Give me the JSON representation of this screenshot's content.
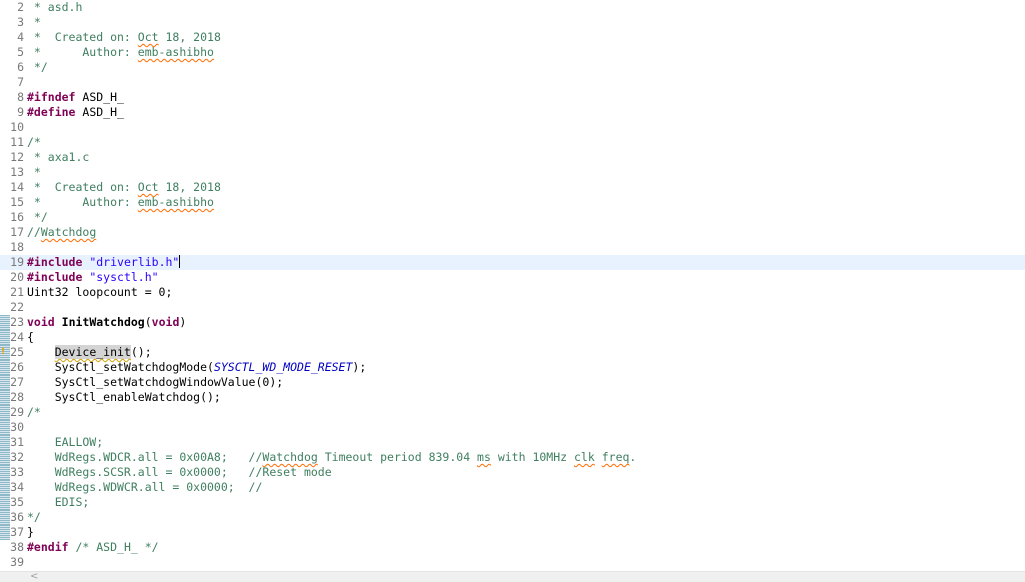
{
  "editor": {
    "current_line": "19",
    "lines": [
      {
        "num": "2",
        "tokens": [
          {
            "t": " * asd.h",
            "c": "cm"
          }
        ]
      },
      {
        "num": "3",
        "tokens": [
          {
            "t": " *",
            "c": "cm"
          }
        ]
      },
      {
        "num": "4",
        "tokens": [
          {
            "t": " *  Created on: ",
            "c": "cm"
          },
          {
            "t": "Oct",
            "c": "cm sq"
          },
          {
            "t": " 18, 2018",
            "c": "cm"
          }
        ]
      },
      {
        "num": "5",
        "tokens": [
          {
            "t": " *      Author: ",
            "c": "cm"
          },
          {
            "t": "emb-ashibho",
            "c": "cm sq"
          }
        ]
      },
      {
        "num": "6",
        "tokens": [
          {
            "t": " */",
            "c": "cm"
          }
        ]
      },
      {
        "num": "7",
        "tokens": []
      },
      {
        "num": "8",
        "tokens": [
          {
            "t": "#ifndef",
            "c": "pre"
          },
          {
            "t": " ASD_H_",
            "c": ""
          }
        ]
      },
      {
        "num": "9",
        "tokens": [
          {
            "t": "#define",
            "c": "pre"
          },
          {
            "t": " ASD_H_",
            "c": ""
          }
        ]
      },
      {
        "num": "10",
        "tokens": []
      },
      {
        "num": "11",
        "tokens": [
          {
            "t": "/*",
            "c": "cm"
          }
        ]
      },
      {
        "num": "12",
        "tokens": [
          {
            "t": " * axa1.c",
            "c": "cm"
          }
        ]
      },
      {
        "num": "13",
        "tokens": [
          {
            "t": " *",
            "c": "cm"
          }
        ]
      },
      {
        "num": "14",
        "tokens": [
          {
            "t": " *  Created on: ",
            "c": "cm"
          },
          {
            "t": "Oct",
            "c": "cm sq"
          },
          {
            "t": " 18, 2018",
            "c": "cm"
          }
        ]
      },
      {
        "num": "15",
        "tokens": [
          {
            "t": " *      Author: ",
            "c": "cm"
          },
          {
            "t": "emb-ashibho",
            "c": "cm sq"
          }
        ]
      },
      {
        "num": "16",
        "tokens": [
          {
            "t": " */",
            "c": "cm"
          }
        ]
      },
      {
        "num": "17",
        "tokens": [
          {
            "t": "//",
            "c": "cm"
          },
          {
            "t": "Watchdog",
            "c": "cm sq"
          }
        ]
      },
      {
        "num": "18",
        "tokens": []
      },
      {
        "num": "19",
        "tokens": [
          {
            "t": "#include",
            "c": "pre"
          },
          {
            "t": " ",
            "c": ""
          },
          {
            "t": "\"driverlib.h\"",
            "c": "str"
          }
        ]
      },
      {
        "num": "20",
        "tokens": [
          {
            "t": "#include",
            "c": "pre"
          },
          {
            "t": " ",
            "c": ""
          },
          {
            "t": "\"sysctl.h\"",
            "c": "str"
          }
        ]
      },
      {
        "num": "21",
        "tokens": [
          {
            "t": "Uint32 loopcount = 0;",
            "c": ""
          }
        ]
      },
      {
        "num": "22",
        "tokens": []
      },
      {
        "num": "23",
        "tokens": [
          {
            "t": "void",
            "c": "kw"
          },
          {
            "t": " ",
            "c": ""
          },
          {
            "t": "InitWatchdog",
            "c": "fn-decl"
          },
          {
            "t": "(",
            "c": ""
          },
          {
            "t": "void",
            "c": "kw"
          },
          {
            "t": ")",
            "c": ""
          }
        ]
      },
      {
        "num": "24",
        "tokens": [
          {
            "t": "{",
            "c": ""
          }
        ]
      },
      {
        "num": "25",
        "tokens": [
          {
            "t": "    ",
            "c": ""
          },
          {
            "t": "Device_init",
            "c": "hl warnsq"
          },
          {
            "t": "();",
            "c": ""
          }
        ]
      },
      {
        "num": "26",
        "tokens": [
          {
            "t": "    SysCtl_setWatchdogMode(",
            "c": ""
          },
          {
            "t": "SYSCTL_WD_MODE_RESET",
            "c": "macro"
          },
          {
            "t": ");",
            "c": ""
          }
        ]
      },
      {
        "num": "27",
        "tokens": [
          {
            "t": "    SysCtl_setWatchdogWindowValue(0);",
            "c": ""
          }
        ]
      },
      {
        "num": "28",
        "tokens": [
          {
            "t": "    SysCtl_enableWatchdog();",
            "c": ""
          }
        ]
      },
      {
        "num": "29",
        "tokens": [
          {
            "t": "/*",
            "c": "cm"
          }
        ]
      },
      {
        "num": "30",
        "tokens": []
      },
      {
        "num": "31",
        "tokens": [
          {
            "t": "    EALLOW;",
            "c": "cm"
          }
        ]
      },
      {
        "num": "32",
        "tokens": [
          {
            "t": "    WdRegs.WDCR.all = 0x00A8;   //",
            "c": "cm"
          },
          {
            "t": "Watchdog",
            "c": "cm sq"
          },
          {
            "t": " Timeout period 839.04 ",
            "c": "cm"
          },
          {
            "t": "ms",
            "c": "cm sq"
          },
          {
            "t": " with 10MHz ",
            "c": "cm"
          },
          {
            "t": "clk",
            "c": "cm sq"
          },
          {
            "t": " ",
            "c": "cm"
          },
          {
            "t": "freq",
            "c": "cm sq"
          },
          {
            "t": ".",
            "c": "cm"
          }
        ]
      },
      {
        "num": "33",
        "tokens": [
          {
            "t": "    WdRegs.SCSR.all = 0x0000;   //Reset mode",
            "c": "cm"
          }
        ]
      },
      {
        "num": "34",
        "tokens": [
          {
            "t": "    WdRegs.WDWCR.all = 0x0000;  //",
            "c": "cm"
          }
        ]
      },
      {
        "num": "35",
        "tokens": [
          {
            "t": "    EDIS;",
            "c": "cm"
          }
        ]
      },
      {
        "num": "36",
        "tokens": [
          {
            "t": "*/",
            "c": "cm"
          }
        ]
      },
      {
        "num": "37",
        "tokens": [
          {
            "t": "}",
            "c": ""
          }
        ]
      },
      {
        "num": "38",
        "tokens": [
          {
            "t": "#endif",
            "c": "pre"
          },
          {
            "t": " ",
            "c": ""
          },
          {
            "t": "/* ASD_H_ */",
            "c": "cm"
          }
        ]
      },
      {
        "num": "39",
        "tokens": []
      }
    ],
    "changed_lines": [
      "23",
      "24",
      "25",
      "26",
      "27",
      "28",
      "29",
      "30",
      "31",
      "32",
      "33",
      "34",
      "35",
      "36",
      "37"
    ],
    "warning_lines": [
      "25"
    ],
    "caret_after_line": "19"
  },
  "scrollbar": {
    "left_arrow": "<"
  }
}
